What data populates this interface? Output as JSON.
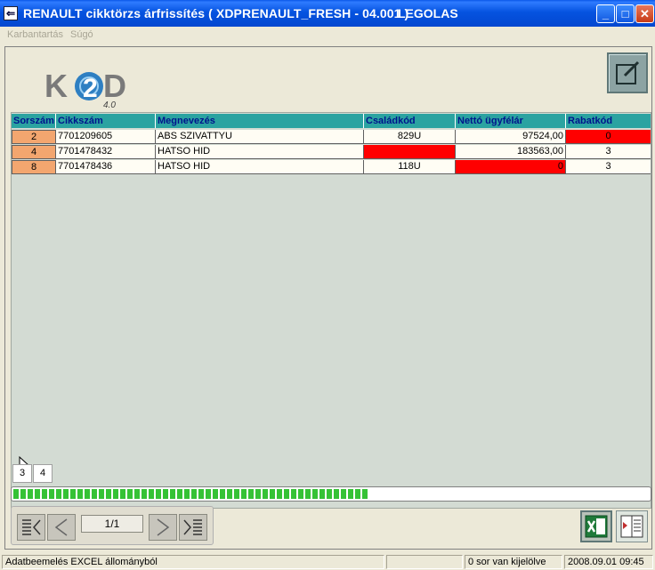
{
  "window": {
    "title": "RENAULT cikktörzs árfrissítés ( XDPRENAULT_FRESH - 04.001 )",
    "user": "LEGOLAS",
    "minimize": "_",
    "maximize": "□",
    "close": "✕"
  },
  "menu": {
    "items": [
      "Karbantartás",
      "Súgó"
    ]
  },
  "logo": {
    "main": "K2D",
    "version": "4.0"
  },
  "table": {
    "columns": [
      "Sorszám",
      "Cikkszám",
      "Megnevezés",
      "Családkód",
      "Nettó ügyfélár",
      "Rabatkód"
    ],
    "rows": [
      {
        "sorszam": "2",
        "cikkszam": "7701209605",
        "megnevezes": "ABS SZIVATTYU",
        "csaladkod": "829U",
        "netto": "97524,00",
        "rabatkod": "0"
      },
      {
        "sorszam": "4",
        "cikkszam": "7701478432",
        "megnevezes": "HATSO HID",
        "csaladkod": "",
        "netto": "183563,00",
        "rabatkod": "3"
      },
      {
        "sorszam": "8",
        "cikkszam": "7701478436",
        "megnevezes": "HATSO HID",
        "csaladkod": "118U",
        "netto": "0",
        "rabatkod": "3"
      }
    ]
  },
  "pages": [
    "3",
    "4"
  ],
  "progress": {
    "fraction": 0.56
  },
  "navigator": {
    "page": "1/1"
  },
  "status": {
    "message": "Adatbeemelés EXCEL állományból",
    "blank": "",
    "selection": "0 sor van kijelölve",
    "datetime": "2008.09.01 09:45"
  },
  "colors": {
    "header": "#2ba3a1",
    "error": "#ff0000",
    "rownum": "#f3a66f",
    "progress": "#35c235"
  }
}
